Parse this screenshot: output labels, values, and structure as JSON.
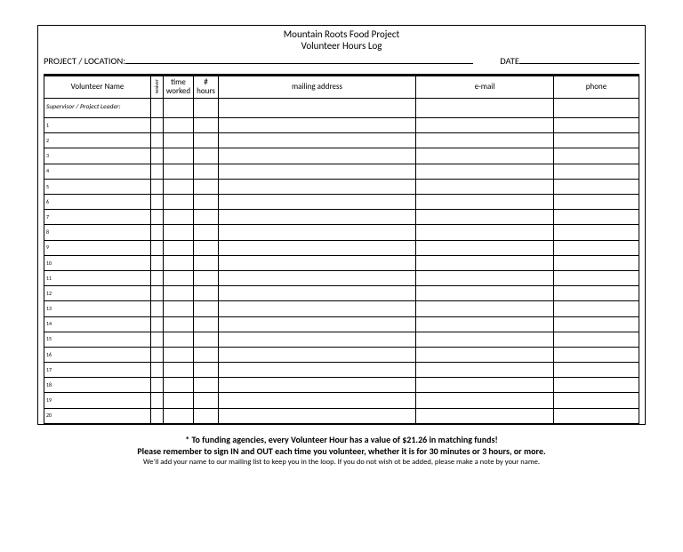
{
  "header": {
    "title1": "Mountain Roots Food Project",
    "title2": "Volunteer Hours Log",
    "project_label": "PROJECT / LOCATION:",
    "date_label": "DATE"
  },
  "columns": {
    "name": "Volunteer Name",
    "waiver": "waiver",
    "time": "time worked",
    "hours": "# hours",
    "addr": "mailing address",
    "email": "e-mail",
    "phone": "phone"
  },
  "supervisor_label": "Supervisor / Project Leader:",
  "rows": [
    "1",
    "2",
    "3",
    "4",
    "5",
    "6",
    "7",
    "8",
    "9",
    "10",
    "11",
    "12",
    "13",
    "14",
    "15",
    "16",
    "17",
    "18",
    "19",
    "20"
  ],
  "footer": {
    "line1": "*  To funding agencies, every Volunteer Hour has a value of  $21.26 in matching funds!",
    "line2": "Please remember to sign IN and OUT each time you volunteer, whether it is for 30 minutes or 3 hours, or more.",
    "line3": "We'll add your name to our mailing list to keep you in the loop. If you do not wish ot be added, please make a note by your name."
  }
}
